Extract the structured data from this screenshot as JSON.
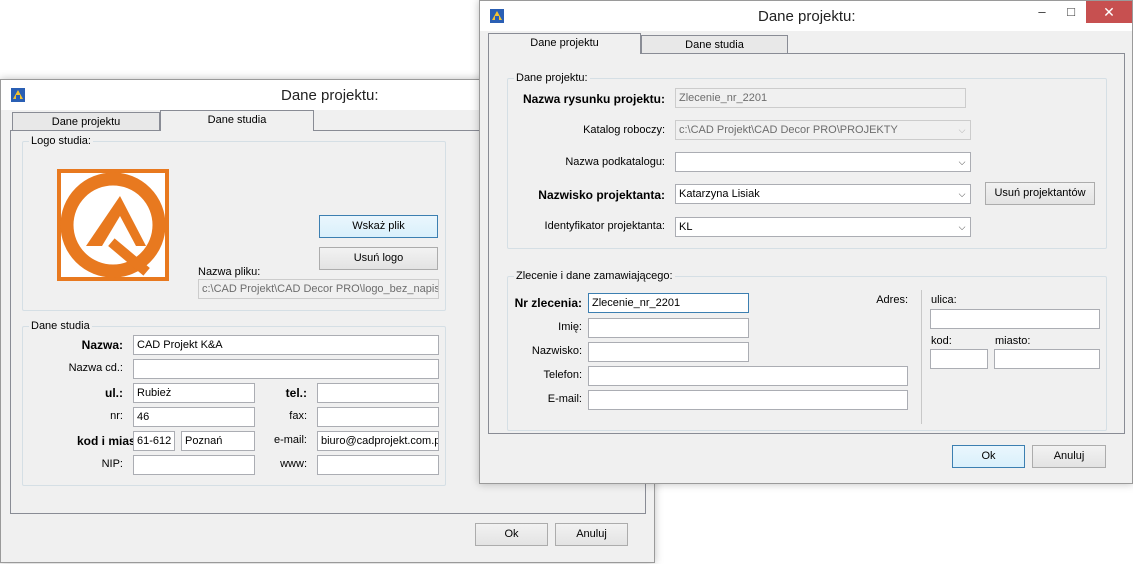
{
  "win1": {
    "title": "Dane projektu:",
    "tabs": [
      "Dane projektu",
      "Dane studia"
    ],
    "logo_group": {
      "label": "Logo studia:",
      "browse_button": "Wskaż plik",
      "remove_logo_button": "Usuń logo",
      "filename_label": "Nazwa pliku:",
      "filename_value": "c:\\CAD Projekt\\CAD Decor PRO\\logo_bez_napis"
    },
    "studio_group": {
      "label": "Dane studia",
      "name_label": "Nazwa:",
      "name_value": "CAD Projekt K&A",
      "name_cd_label": "Nazwa cd.:",
      "name_cd_value": "",
      "street_label": "ul.:",
      "street_value": "Rubież",
      "tel_label": "tel.:",
      "tel_value": "",
      "nr_label": "nr:",
      "nr_value": "46",
      "fax_label": "fax:",
      "fax_value": "",
      "postal_label": "kod i miasto:",
      "postal_code": "61-612",
      "city": "Poznań",
      "email_label": "e-mail:",
      "email_value": "biuro@cadprojekt.com.p",
      "nip_label": "NIP:",
      "nip_value": "",
      "www_label": "www:",
      "www_value": ""
    },
    "ok_button": "Ok",
    "cancel_button": "Anuluj"
  },
  "win2": {
    "title": "Dane projektu:",
    "tabs": [
      "Dane projektu",
      "Dane studia"
    ],
    "project_group": {
      "label": "Dane projektu:",
      "drawing_name_label": "Nazwa rysunku projektu:",
      "drawing_name_value": "Zlecenie_nr_2201",
      "work_dir_label": "Katalog roboczy:",
      "work_dir_value": "c:\\CAD Projekt\\CAD Decor PRO\\PROJEKTY",
      "subdir_label": "Nazwa podkatalogu:",
      "subdir_value": "",
      "designer_label": "Nazwisko projektanta:",
      "designer_value": "Katarzyna Lisiak",
      "remove_designers_button": "Usuń projektantów",
      "designer_id_label": "Identyfikator projektanta:",
      "designer_id_value": "KL"
    },
    "order_group": {
      "label": "Zlecenie i dane zamawiającego:",
      "order_nr_label": "Nr zlecenia:",
      "order_nr_value": "Zlecenie_nr_2201",
      "first_name_label": "Imię:",
      "first_name_value": "",
      "last_name_label": "Nazwisko:",
      "last_name_value": "",
      "phone_label": "Telefon:",
      "phone_value": "",
      "email_label": "E-mail:",
      "email_value": "",
      "address_label": "Adres:",
      "street_label": "ulica:",
      "street_value": "",
      "postcode_label": "kod:",
      "postcode_value": "",
      "city_label": "miasto:",
      "city_value": ""
    },
    "ok_button": "Ok",
    "cancel_button": "Anuluj"
  },
  "colors": {
    "logo_orange": "#e8791f",
    "close_red": "#c75050",
    "focus_blue": "#3c7fb1"
  }
}
